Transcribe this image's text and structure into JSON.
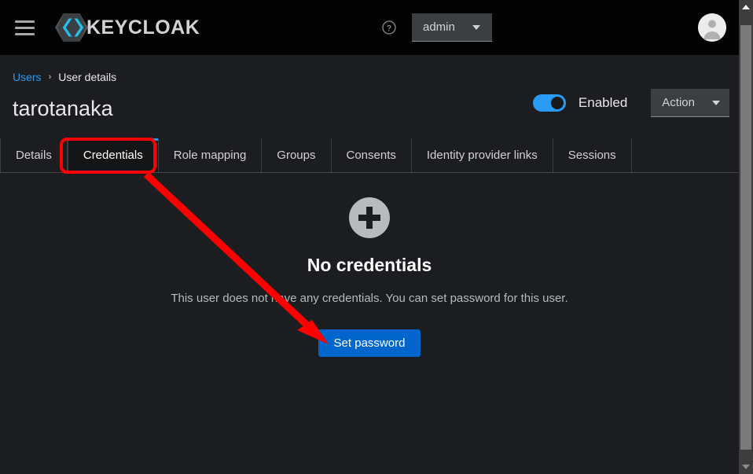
{
  "masthead": {
    "menu_icon": "hamburger-icon",
    "brand_text": "KEYCLOAK",
    "brand_mark": "keycloak-logo-icon",
    "help_icon": "help-circle-icon",
    "admin_menu": {
      "label": "admin",
      "caret": "chevron-down-icon"
    },
    "avatar": "user-avatar-icon"
  },
  "breadcrumb": {
    "parent": "Users",
    "separator": "›",
    "current": "User details"
  },
  "page": {
    "title": "tarotanaka",
    "enabled_toggle": {
      "label": "Enabled",
      "state": "on"
    },
    "action_menu": {
      "label": "Action",
      "caret": "chevron-down-icon"
    }
  },
  "tabs": [
    {
      "label": "Details",
      "active": false
    },
    {
      "label": "Credentials",
      "active": true
    },
    {
      "label": "Role mapping",
      "active": false
    },
    {
      "label": "Groups",
      "active": false
    },
    {
      "label": "Consents",
      "active": false
    },
    {
      "label": "Identity provider links",
      "active": false
    },
    {
      "label": "Sessions",
      "active": false
    }
  ],
  "empty_state": {
    "icon": "plus-circle-icon",
    "title": "No credentials",
    "body": "This user does not have any credentials. You can set password for this user.",
    "button_label": "Set password"
  },
  "scrollbar": {
    "up_icon": "scroll-up-arrow-icon",
    "down_icon": "scroll-down-arrow-icon"
  },
  "annotations": {
    "highlight_color": "#ff0000",
    "highlight_target": "Credentials",
    "arrow_target": "Set password"
  },
  "colors": {
    "accent_blue": "#2b9af3",
    "primary_button": "#0066cc",
    "masthead_bg": "#030303",
    "body_bg": "#1b1d21",
    "annotation_red": "#ff0000"
  }
}
